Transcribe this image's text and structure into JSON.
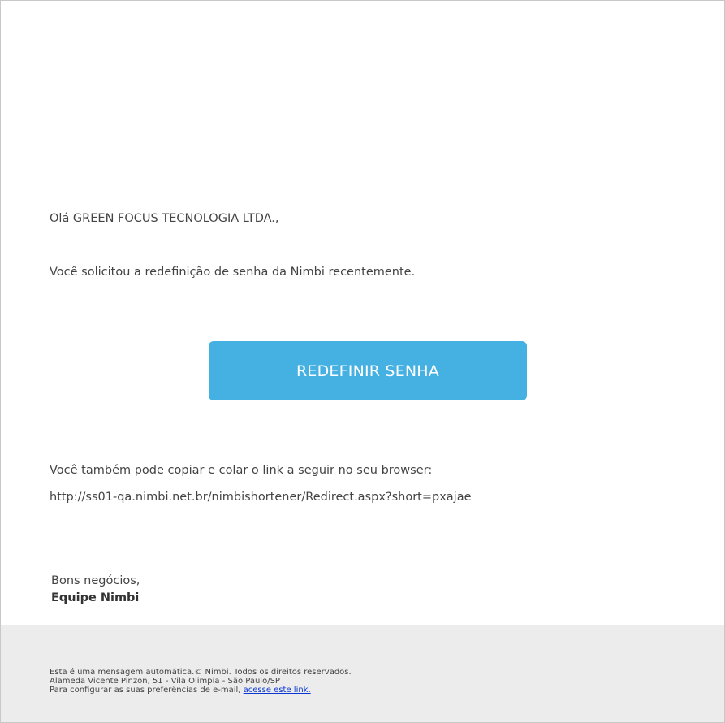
{
  "email": {
    "greeting": "Olá GREEN FOCUS TECNOLOGIA LTDA.,",
    "intro": "Você solicitou a redefinição de senha da Nimbi recentemente.",
    "button_label": "REDEFINIR SENHA",
    "copy_hint": "Você também pode copiar e colar o link a seguir no seu browser:",
    "fallback_url": "http://ss01-qa.nimbi.net.br/nimbishortener/Redirect.aspx?short=pxajae",
    "signoff": "Bons negócios,",
    "team": "Equipe Nimbi"
  },
  "footer": {
    "line1": "Esta é uma mensagem automática.© Nimbi. Todos os direitos reservados.",
    "line2": "Alameda Vicente Pinzon, 51 - Vila Olimpia - São Paulo/SP",
    "line3_prefix": "Para configurar as suas preferências de e-mail, ",
    "line3_link": "acesse este link."
  },
  "colors": {
    "button_bg": "#45b1e3",
    "button_text": "#ffffff",
    "footer_bg": "#ececec",
    "body_text": "#444444",
    "link": "#0a37d1"
  }
}
